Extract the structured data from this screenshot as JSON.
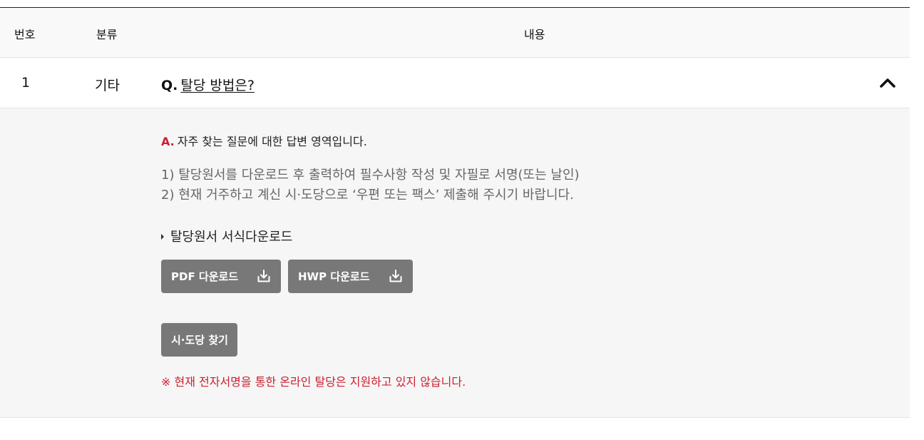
{
  "table": {
    "headers": {
      "no": "번호",
      "category": "분류",
      "content": "내용"
    }
  },
  "faq": {
    "number": "1",
    "category": "기타",
    "q_mark": "Q.",
    "question": "탈당 방법은?",
    "expanded": true,
    "toggle_icon": "chevron-up-icon",
    "a_mark": "A.",
    "answer_intro": "자주 찾는 질문에 대한 답변 영역입니다.",
    "steps": [
      "1) 탈당원서를 다운로드 후 출력하여 필수사항 작성 및 자필로 서명(또는 날인)",
      "2) 현재 거주하고 계신 시·도당으로 ‘우편 또는 팩스’ 제출해 주시기 바랍니다."
    ],
    "form_title": "탈당원서 서식다운로드",
    "buttons": {
      "pdf": "PDF 다운로드",
      "hwp": "HWP 다운로드",
      "download_icon": "download-icon",
      "sido": "시·도당 찾기"
    },
    "notice": "※ 현재 전자서명을 통한 온라인 탈당은 지원하고 있지 않습니다."
  },
  "colors": {
    "accent_red": "#cc1f2f",
    "button_gray": "#787878",
    "answer_bg": "#f6f6f6"
  }
}
